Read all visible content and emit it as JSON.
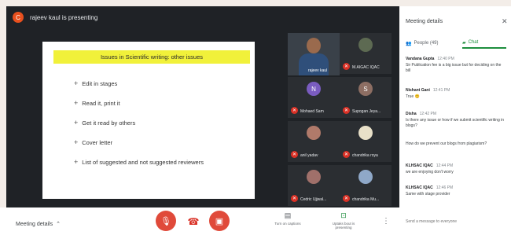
{
  "presenter_bar": {
    "avatar_letter": "C",
    "text": "rajeev kaul is presenting"
  },
  "slide": {
    "title": "Issues in Scientific writing: other issues",
    "bullets": [
      "Edit in stages",
      "Read it, print it",
      "Get it read by others",
      "Cover letter",
      "List of suggested and not suggested reviewers"
    ]
  },
  "presenter_tile": {
    "name": "rajeev kaul"
  },
  "participants": [
    {
      "initial": "",
      "name": "M.AIGAC IQAC",
      "color": "#5d6a52"
    },
    {
      "initial": "N",
      "name": "Mohaed Sam",
      "color": "#7a5cc0"
    },
    {
      "initial": "S",
      "name": "Supogan Jeya...",
      "color": "#8d6e63"
    },
    {
      "initial": "",
      "name": "anil yadav",
      "color": "#b07a6a"
    },
    {
      "initial": "",
      "name": "chandrika roya",
      "color": "#e8e0c8"
    },
    {
      "initial": "",
      "name": "Cedric Ujjwal...",
      "color": "#a0706a"
    },
    {
      "initial": "",
      "name": "chandrika Mu...",
      "color": "#8fa8c8"
    }
  ],
  "panel": {
    "title": "Meeting details",
    "close_icon": "close-icon",
    "tab_people": "People (49)",
    "tab_chat": "Chat",
    "messages": [
      {
        "sender": "Vandana Gupta",
        "time": "12:40 PM",
        "text": "Sir Publication fee is a big issue but for deciding on the bill"
      },
      {
        "sender": "Nishant Gani",
        "time": "12:41 PM",
        "text": "True 😊"
      },
      {
        "sender": "Disha",
        "time": "12:42 PM",
        "text": "Is there any issue or how if we submit scientific writing in blogs?"
      },
      {
        "sender": "",
        "time": "",
        "text": "How do we prevent our blogs from plagiarism?"
      },
      {
        "sender": "KLHSAC IQAC",
        "time": "12:44 PM",
        "text": "we are enjoying don't worry"
      },
      {
        "sender": "KLHSAC IQAC",
        "time": "12:46 PM",
        "text": "Same with stage provider"
      }
    ],
    "input_placeholder": "Send a message to everyone"
  },
  "toolbar": {
    "meeting_details": "Meeting details",
    "captions_label": "Turn on captions",
    "present_label": "Uptaks bout is presenting"
  },
  "colors": {
    "accent_red": "#e04a3a",
    "chat_green": "#1e8e3e",
    "stage_bg": "#1f2226"
  }
}
